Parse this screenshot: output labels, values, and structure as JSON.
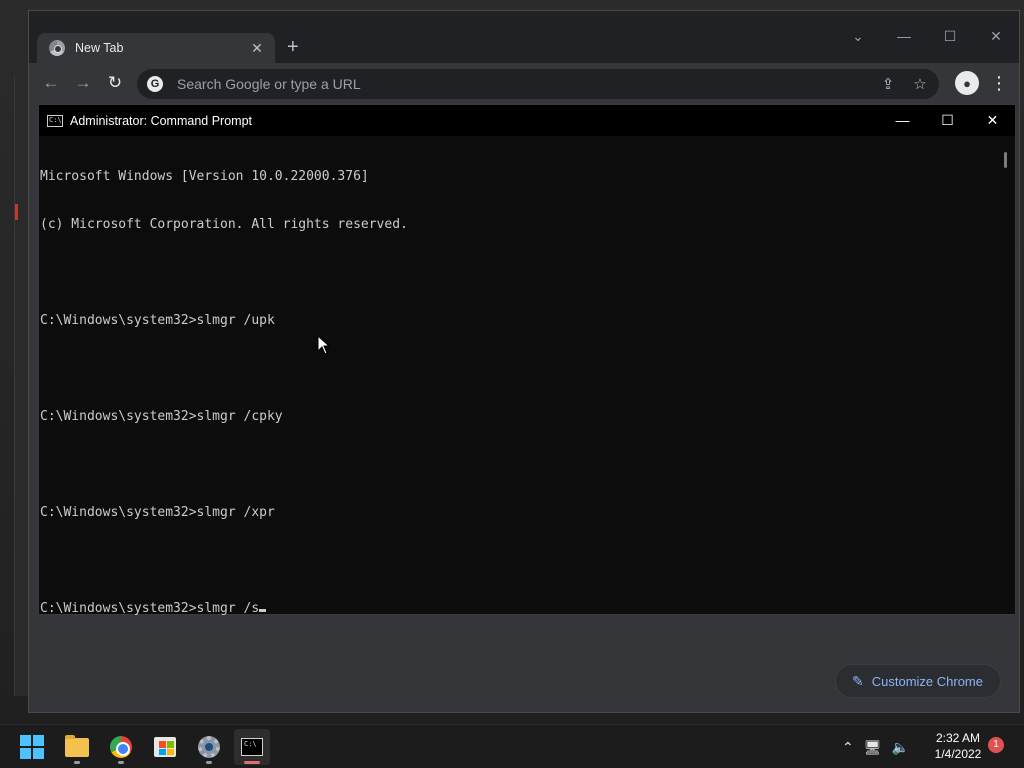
{
  "chrome": {
    "tab_title": "New Tab",
    "new_tab_symbol": "+",
    "omnibox_placeholder": "Search Google or type a URL",
    "customize_label": "Customize Chrome",
    "window_controls": [
      "⌄",
      "—",
      "☐",
      "✕"
    ]
  },
  "cmd": {
    "title": "Administrator: Command Prompt",
    "icon_text": "C:\\",
    "lines": [
      "Microsoft Windows [Version 10.0.22000.376]",
      "(c) Microsoft Corporation. All rights reserved.",
      "",
      "C:\\Windows\\system32>slmgr /upk",
      "",
      "C:\\Windows\\system32>slmgr /cpky",
      "",
      "C:\\Windows\\system32>slmgr /xpr",
      "",
      "C:\\Windows\\system32>slmgr /s"
    ],
    "window_controls": [
      "—",
      "☐",
      "✕"
    ]
  },
  "taskbar": {
    "apps": [
      "start",
      "file-explorer",
      "chrome",
      "microsoft-store",
      "settings",
      "command-prompt"
    ],
    "active_app": "command-prompt",
    "clock_time": "2:32 AM",
    "clock_date": "1/4/2022",
    "notification_count": "1"
  },
  "colors": {
    "accent_blue": "#8ab4f8",
    "terminal_bg": "#0c0c0c",
    "terminal_text": "#cccccc",
    "notification_red": "#e05252"
  }
}
